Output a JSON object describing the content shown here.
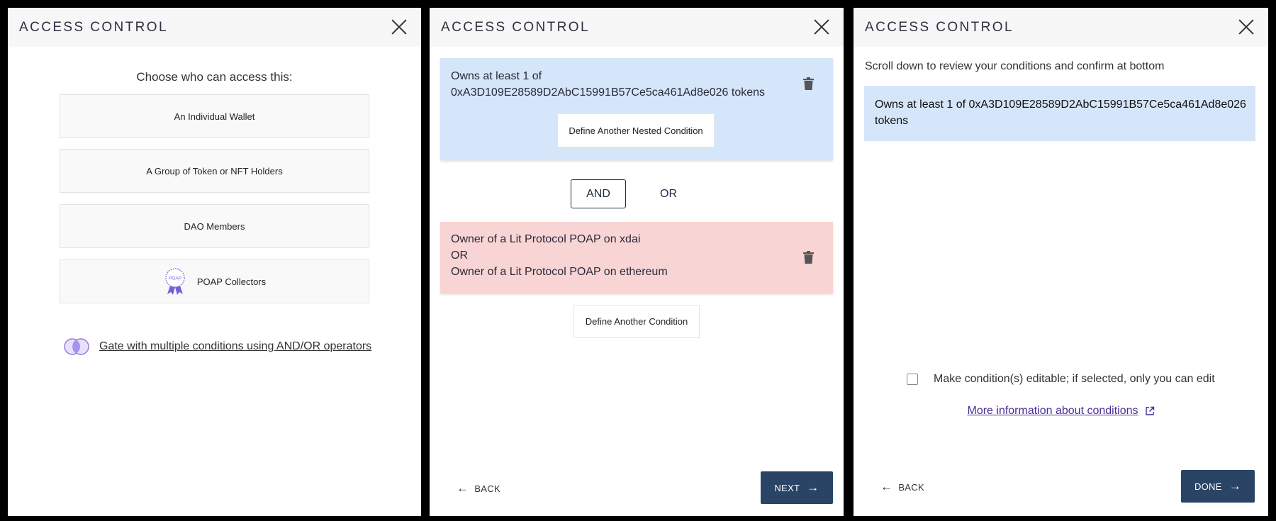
{
  "panel1": {
    "title": "ACCESS CONTROL",
    "prompt": "Choose who can access this:",
    "options": [
      {
        "label": "An Individual Wallet"
      },
      {
        "label": "A Group of Token or NFT Holders"
      },
      {
        "label": "DAO Members"
      },
      {
        "label": "POAP Collectors",
        "icon": "poap-badge-icon",
        "icon_text": "POAP"
      }
    ],
    "gate_link": "Gate with multiple conditions using AND/OR operators",
    "gate_icon": "venn-icon"
  },
  "panel2": {
    "title": "ACCESS CONTROL",
    "condition_group_1": {
      "line1": "Owns at least 1 of",
      "line2": "0xA3D109E28589D2AbC15991B57Ce5ca461Ad8e026 tokens",
      "nested_button": "Define Another Nested Condition",
      "background": "#d5e5fa"
    },
    "operators": {
      "and": "AND",
      "or": "OR",
      "selected": "AND"
    },
    "condition_group_2": {
      "line1": "Owner of a Lit Protocol POAP on xdai",
      "line2": "OR",
      "line3": "Owner of a Lit Protocol POAP on ethereum",
      "background": "#f9d4d4"
    },
    "define_button": "Define Another Condition",
    "back": {
      "arrow": "←",
      "label": "BACK"
    },
    "next": {
      "label": "NEXT",
      "arrow": "→"
    }
  },
  "panel3": {
    "title": "ACCESS CONTROL",
    "hint": "Scroll down to review your conditions and confirm at bottom",
    "review": "Owns at least 1 of 0xA3D109E28589D2AbC15991B57Ce5ca461Ad8e026 tokens",
    "editable_label": "Make condition(s) editable; if selected, only you can edit",
    "editable_checked": false,
    "info_link": "More information about conditions",
    "back": {
      "arrow": "←",
      "label": "BACK"
    },
    "done": {
      "label": "DONE",
      "arrow": "→"
    }
  },
  "colors": {
    "primary_button": "#2a4466",
    "link": "#4a2d96",
    "header_bg": "#f7f7f7"
  }
}
